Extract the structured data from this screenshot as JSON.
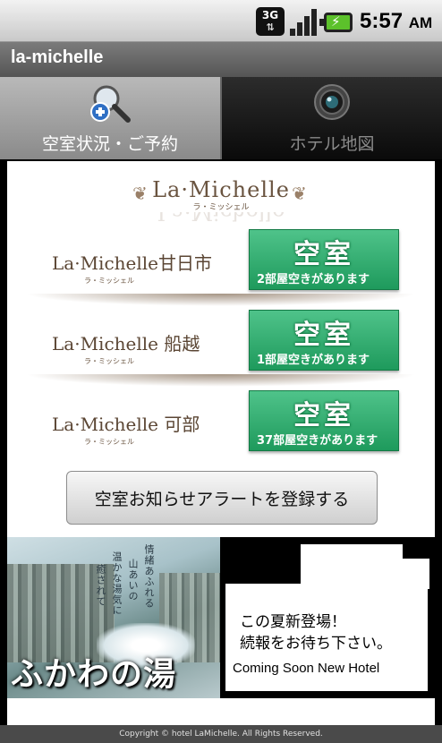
{
  "status_bar": {
    "network": "3G",
    "time": "5:57",
    "ampm": "AM"
  },
  "app": {
    "title": "la-michelle"
  },
  "tabs": [
    {
      "label": "空室状況・ご予約",
      "icon": "search-plus-icon"
    },
    {
      "label": "ホテル地図",
      "icon": "camera-lens-icon"
    }
  ],
  "brand": {
    "name": "La·Michelle",
    "kana": "ラ・ミッシェル"
  },
  "hotels": [
    {
      "name": "La·Michelle甘日市",
      "kana": "ラ・ミッシェル",
      "status": "空室",
      "rooms": "2部屋空きがあります"
    },
    {
      "name": "La·Michelle 船越",
      "kana": "ラ・ミッシェル",
      "status": "空室",
      "rooms": "1部屋空きがあります"
    },
    {
      "name": "La·Michelle 可部",
      "kana": "ラ・ミッシェル",
      "status": "空室",
      "rooms": "37部屋空きがあります"
    }
  ],
  "alert_button": {
    "label": "空室お知らせアラートを登録する"
  },
  "banner_left": {
    "title": "ふかわの湯",
    "vertical_texts": [
      "情緒あふれる",
      "山あいの",
      "温かな湯気に",
      "癒されて"
    ]
  },
  "banner_right": {
    "line1": "この夏新登場！",
    "line2": "続報をお待ち下さい。",
    "line3": "Coming Soon New Hotel"
  },
  "footer": {
    "copyright": "Copyright © hotel LaMichelle. All Rights Reserved."
  },
  "colors": {
    "vacancy_green": "#1e9a5c",
    "brand_brown": "#6a5440",
    "title_bar": "#6a6a6a"
  }
}
